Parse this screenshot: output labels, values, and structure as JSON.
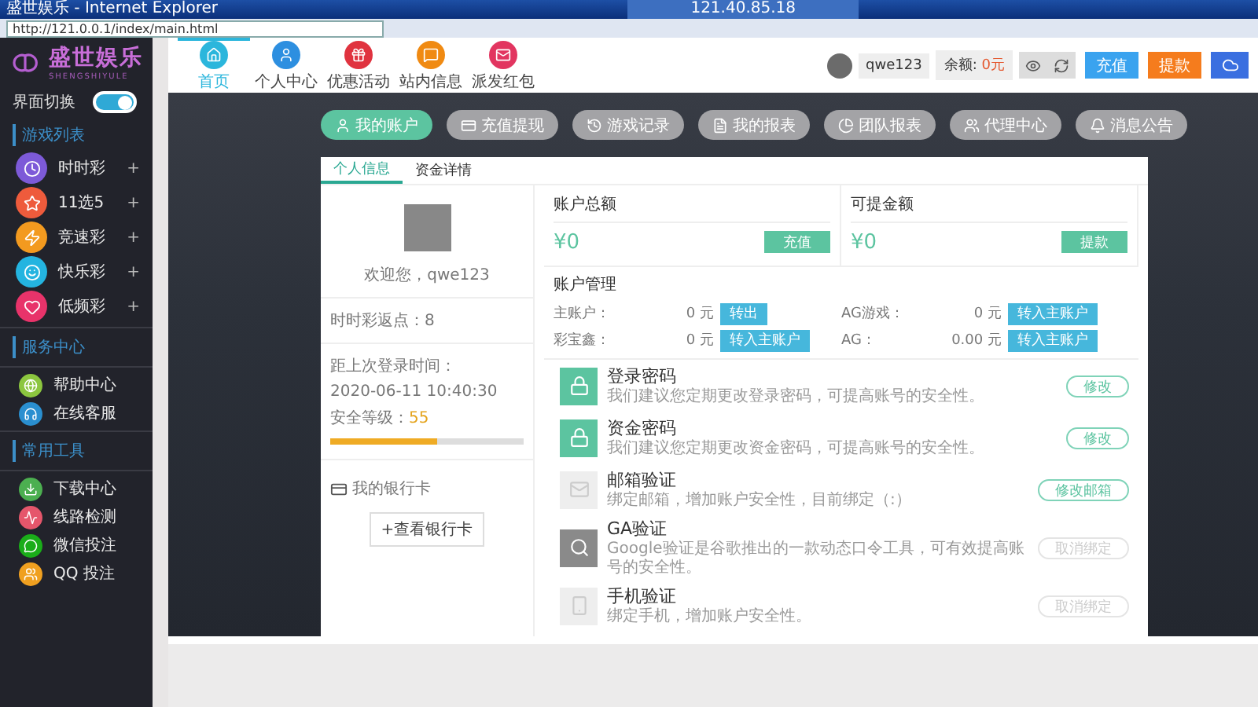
{
  "browser": {
    "title": "盛世娱乐 - Internet Explorer",
    "address": "http://121.0.0.1/index/main.html",
    "remote_title": "121.40.85.18"
  },
  "sidebar": {
    "logo": "盛世娱乐",
    "logo_sub": "SHENGSHIYULE",
    "switch": {
      "label": "界面切换",
      "on": true
    },
    "sections": [
      {
        "title": "游戏列表",
        "kind": "games",
        "items": [
          {
            "label": "时时彩",
            "expand": "+",
            "color": "#7d5ad8"
          },
          {
            "label": "11选5",
            "expand": "+",
            "color": "#ee5b3c"
          },
          {
            "label": "竞速彩",
            "expand": "+",
            "color": "#f39a1f"
          },
          {
            "label": "快乐彩",
            "expand": "+",
            "color": "#24b4e0"
          },
          {
            "label": "低频彩",
            "expand": "+",
            "color": "#e8336a"
          }
        ]
      },
      {
        "title": "服务中心",
        "kind": "tools",
        "items": [
          {
            "label": "帮助中心",
            "color": "#8cc63f"
          },
          {
            "label": "在线客服",
            "color": "#2a8fd0"
          }
        ]
      },
      {
        "title": "常用工具",
        "kind": "tools",
        "items": [
          {
            "label": "下载中心",
            "color": "#4caf50"
          },
          {
            "label": "线路检测",
            "color": "#e5566b"
          },
          {
            "label": "微信投注",
            "color": "#1aad19"
          },
          {
            "label": "QQ 投注",
            "color": "#f0a020"
          }
        ]
      }
    ]
  },
  "topnav": {
    "items": [
      {
        "label": "首页",
        "selected": true,
        "color": "#2bb6dc"
      },
      {
        "label": "个人中心",
        "selected": false,
        "color": "#2d8fe0"
      },
      {
        "label": "优惠活动",
        "selected": false,
        "color": "#e0333f"
      },
      {
        "label": "站内信息",
        "selected": false,
        "color": "#f08a12"
      },
      {
        "label": "派发红包",
        "selected": false,
        "color": "#e23560"
      }
    ],
    "user": "qwe123",
    "balance_label": "余额:",
    "balance": "0元",
    "buttons": [
      {
        "label": "充值",
        "kind": "recharge"
      },
      {
        "label": "提款",
        "kind": "withdraw"
      }
    ]
  },
  "pills": [
    {
      "label": "我的账户",
      "selected": true
    },
    {
      "label": "充值提现",
      "selected": false
    },
    {
      "label": "游戏记录",
      "selected": false
    },
    {
      "label": "我的报表",
      "selected": false
    },
    {
      "label": "团队报表",
      "selected": false
    },
    {
      "label": "代理中心",
      "selected": false
    },
    {
      "label": "消息公告",
      "selected": false
    }
  ],
  "card": {
    "tabs": [
      {
        "label": "个人信息",
        "selected": true
      },
      {
        "label": "资金详情",
        "selected": false
      }
    ],
    "profile": {
      "welcome": "欢迎您，qwe123",
      "rebate": "时时彩返点：8",
      "last_login_label": "距上次登录时间：",
      "last_login": "2020-06-11 10:40:30",
      "security_label": "安全等级：",
      "security_value": "55",
      "level": 0.55,
      "bank_title": "我的银行卡",
      "bank_button": "+查看银行卡"
    },
    "balances": [
      {
        "title": "账户总额",
        "amount": "¥0",
        "action": "充值"
      },
      {
        "title": "可提金额",
        "amount": "¥0",
        "action": "提款"
      }
    ],
    "management": {
      "title": "账户管理",
      "rows": [
        {
          "name": "主账户：",
          "amount": "0",
          "unit": "元",
          "action": "转出"
        },
        {
          "name": "AG游戏：",
          "amount": "0",
          "unit": "元",
          "action": "转入主账户"
        },
        {
          "name": "彩宝鑫：",
          "amount": "0",
          "unit": "元",
          "action": "转入主账户"
        },
        {
          "name": "AG：",
          "amount": "0.00",
          "unit": "元",
          "action": "转入主账户"
        }
      ]
    },
    "security": [
      {
        "title": "登录密码",
        "desc": "我们建议您定期更改登录密码，可提高账号的安全性。",
        "action": "修改",
        "disabled": false,
        "color": "#5cc4a0"
      },
      {
        "title": "资金密码",
        "desc": "我们建议您定期更改资金密码，可提高账号的安全性。",
        "action": "修改",
        "disabled": false,
        "color": "#5cc4a0"
      },
      {
        "title": "邮箱验证",
        "desc": "绑定邮箱，增加账户安全性，目前绑定（:）",
        "action": "修改邮箱",
        "disabled": false,
        "color": "#eeeeee"
      },
      {
        "title": "GA验证",
        "desc": "Google验证是谷歌推出的一款动态口令工具，可有效提高账号的安全性。",
        "action": "取消绑定",
        "disabled": true,
        "color": "#8a8a8a"
      },
      {
        "title": "手机验证",
        "desc": "绑定手机，增加账户安全性。",
        "action": "取消绑定",
        "disabled": true,
        "color": "#eeeeee"
      }
    ]
  }
}
